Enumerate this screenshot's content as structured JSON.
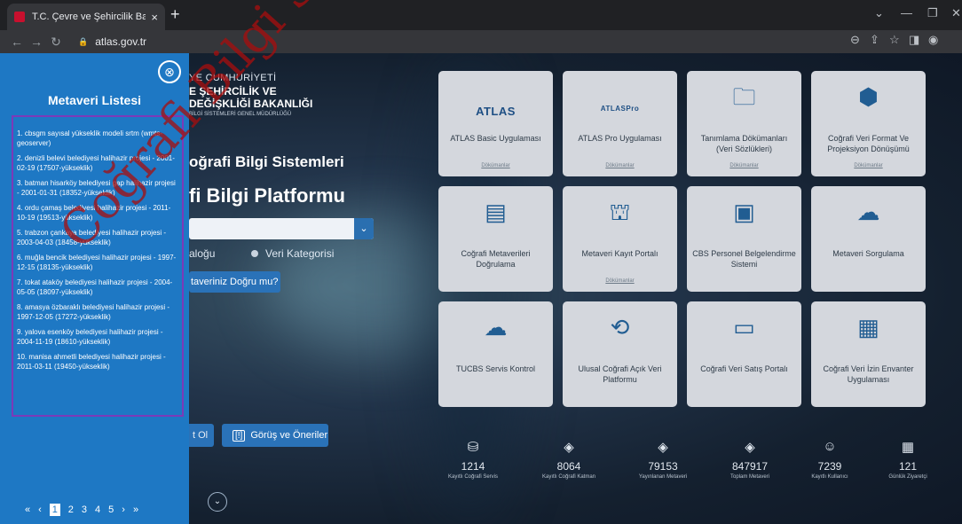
{
  "browser": {
    "tab_title": "T.C. Çevre ve Şehircilik Bakanlığı",
    "tab_close": "×",
    "new_tab": "+",
    "url": "atlas.gov.tr",
    "win_controls": [
      "⌄",
      "—",
      "❐",
      "✕"
    ]
  },
  "sidebar": {
    "close_icon": "⊗",
    "title": "Metaveri Listesi",
    "items": [
      "1. cbsgm sayısal yükseklik modeli srtm (wmts-geoserver)",
      "2. denizli belevi belediyesi halihazir projesi - 2001-02-19 (17507-yükseklik)",
      "3. batman hisarköy belediyesi gap halihazir projesi - 2001-01-31 (18352-yükseklik)",
      "4. ordu çamaş belediyesi halihazir projesi - 2011-10-19 (19513-yükseklik)",
      "5. trabzon çankaya belediyesi halihazir projesi - 2003-04-03 (18458-yükseklik)",
      "6. muğla bencik belediyesi halihazir projesi - 1997-12-15 (18135-yükseklik)",
      "7. tokat ataköy belediyesi halihazir projesi - 2004-05-05 (18097-yükseklik)",
      "8. amasya özbaraklı belediyesi halihazir projesi - 1997-12-05 (17272-yükseklik)",
      "9. yalova esenköy belediyesi halihazir projesi - 2004-11-19 (18610-yükseklik)",
      "10. manisa ahmetli belediyesi halihazir projesi - 2011-03-11 (19450-yükseklik)"
    ],
    "pager": {
      "first": "«",
      "prev": "‹",
      "pages": [
        "1",
        "2",
        "3",
        "4",
        "5"
      ],
      "next": "›",
      "last": "»"
    }
  },
  "hero": {
    "line1": "YE CUMHURİYETİ",
    "line2": "E ŞEHİRCİLİK VE",
    "line3": "DEĞİŞKLİĞİ BAKANLIĞI",
    "line4": "BİLGİ SİSTEMLERİ GENEL MÜDÜRLÜĞÜ",
    "subtitle": "oğrafi Bilgi Sistemleri",
    "title": "fi Bilgi Platformu",
    "radio1": "aloğu",
    "radio2": "Veri Kategorisi",
    "question_btn": "taveriniz Doğru mu?",
    "footer_btn1": "t Ol",
    "footer_btn2": "Görüş ve Öneriler",
    "footer_btn2_icon": "[!]",
    "scroll_icon": "⌄",
    "dropdown_icon": "⌄"
  },
  "cards": [
    {
      "label": "ATLAS Basic Uygulaması",
      "logo": "ATLAS",
      "doc": "Dökümanlar",
      "icon": ""
    },
    {
      "label": "ATLAS Pro Uygulaması",
      "logo": "ATLASPro",
      "doc": "Dökümanlar",
      "icon": ""
    },
    {
      "label": "Tanımlama Dökümanları (Veri Sözlükleri)",
      "logo": "",
      "doc": "Dökümanlar",
      "icon": "🗀"
    },
    {
      "label": "Coğrafi Veri Format Ve Projeksiyon Dönüşümü",
      "logo": "",
      "doc": "Dökümanlar",
      "icon": "⬢"
    },
    {
      "label": "Coğrafi Metaverileri Doğrulama",
      "logo": "",
      "doc": "",
      "icon": "▤"
    },
    {
      "label": "Metaveri Kayıt Portalı",
      "logo": "",
      "doc": "Dökümanlar",
      "icon": "⛫"
    },
    {
      "label": "CBS Personel Belgelendirme Sistemi",
      "logo": "",
      "doc": "",
      "icon": "▣"
    },
    {
      "label": "Metaveri Sorgulama",
      "logo": "",
      "doc": "",
      "icon": "☁"
    },
    {
      "label": "TUCBS Servis Kontrol",
      "logo": "",
      "doc": "",
      "icon": "☁"
    },
    {
      "label": "Ulusal Coğrafi Açık Veri Platformu",
      "logo": "",
      "doc": "",
      "icon": "⟲"
    },
    {
      "label": "Coğrafi Veri Satış Portalı",
      "logo": "",
      "doc": "",
      "icon": "▭"
    },
    {
      "label": "Coğrafi Veri İzin Envanter Uygulaması",
      "logo": "",
      "doc": "",
      "icon": "▦"
    }
  ],
  "stats": [
    {
      "value": "1214",
      "label": "Kayıtlı Coğrafi Servis",
      "icon": "⛁"
    },
    {
      "value": "8064",
      "label": "Kayıtlı Coğrafi Katman",
      "icon": "◈"
    },
    {
      "value": "79153",
      "label": "Yayınlanan Metaveri",
      "icon": "◈"
    },
    {
      "value": "847917",
      "label": "Toplam Metaveri",
      "icon": "◈"
    },
    {
      "value": "7239",
      "label": "Kayıtlı Kullanıcı",
      "icon": "☺"
    },
    {
      "value": "121",
      "label": "Günlük Ziyaretçi",
      "icon": "▦"
    }
  ],
  "watermark": "Coğrafi Bilgi Sistemleri"
}
